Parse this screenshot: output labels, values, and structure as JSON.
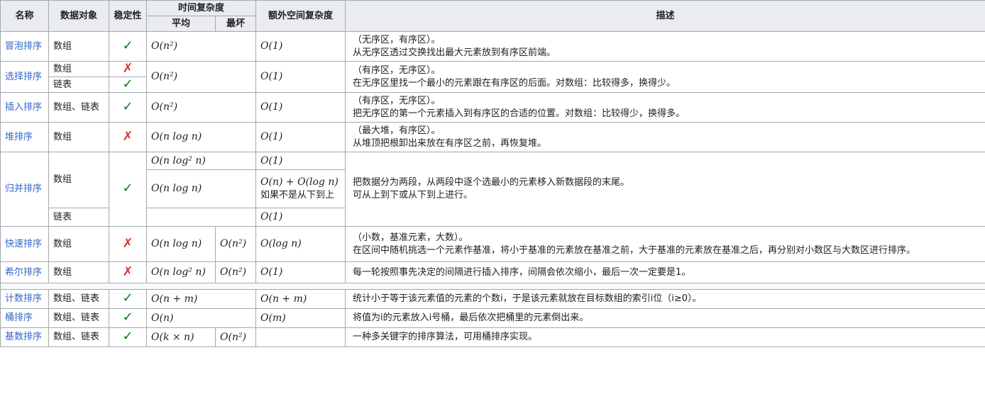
{
  "headers": {
    "name": "名称",
    "data_object": "数据对象",
    "stable": "稳定性",
    "time": "时间复杂度",
    "avg": "平均",
    "worst": "最坏",
    "space": "额外空间复杂度",
    "desc": "描述"
  },
  "icons": {
    "check": "✓",
    "cross": "✗",
    "check_color": "#008000",
    "cross_color": "#dd3333"
  },
  "rows": {
    "bubble": {
      "name": "冒泡排序",
      "obj": "数组",
      "avg": "O(n²)",
      "space": "O(1)",
      "desc1": "（无序区，有序区）。",
      "desc2": "从无序区透过交换找出最大元素放到有序区前端。"
    },
    "selection": {
      "name": "选择排序",
      "obj1": "数组",
      "obj2": "链表",
      "avg": "O(n²)",
      "space": "O(1)",
      "desc1": "（有序区，无序区）。",
      "desc2": "在无序区里找一个最小的元素跟在有序区的后面。对数组：比较得多，换得少。"
    },
    "insertion": {
      "name": "插入排序",
      "obj": "数组、链表",
      "avg": "O(n²)",
      "space": "O(1)",
      "desc1": "（有序区，无序区）。",
      "desc2": "把无序区的第一个元素插入到有序区的合适的位置。对数组：比较得少，换得多。"
    },
    "heap": {
      "name": "堆排序",
      "obj": "数组",
      "avg": "O(n log n)",
      "space": "O(1)",
      "desc1": "（最大堆，有序区）。",
      "desc2": "从堆顶把根卸出来放在有序区之前，再恢复堆。"
    },
    "merge": {
      "name": "归并排序",
      "obj1": "数组",
      "obj2": "链表",
      "avg1": "O(n log² n)",
      "avg2": "O(n log n)",
      "space1": "O(1)",
      "space2": "O(n) + O(log n)",
      "space2_note": "如果不是从下到上",
      "space3": "O(1)",
      "desc1": "把数据分为两段，从两段中逐个选最小的元素移入新数据段的末尾。",
      "desc2": "可从上到下或从下到上进行。"
    },
    "quick": {
      "name": "快速排序",
      "obj": "数组",
      "avg": "O(n log n)",
      "worst": "O(n²)",
      "space": "O(log n)",
      "desc1": "（小数，基准元素，大数）。",
      "desc2": "在区间中随机挑选一个元素作基准，将小于基准的元素放在基准之前，大于基准的元素放在基准之后，再分别对小数区与大数区进行排序。"
    },
    "shell": {
      "name": "希尔排序",
      "obj": "数组",
      "avg": "O(n log² n)",
      "worst": "O(n²)",
      "space": "O(1)",
      "desc": "每一轮按照事先决定的间隔进行插入排序，间隔会依次缩小，最后一次一定要是1。"
    },
    "counting": {
      "name": "计数排序",
      "obj": "数组、链表",
      "avg": "O(n + m)",
      "space": "O(n + m)",
      "desc": "统计小于等于该元素值的元素的个数i，于是该元素就放在目标数组的索引i位（i≥0）。"
    },
    "bucket": {
      "name": "桶排序",
      "obj": "数组、链表",
      "avg": "O(n)",
      "space": "O(m)",
      "desc": "将值为i的元素放入i号桶，最后依次把桶里的元素倒出来。"
    },
    "radix": {
      "name": "基数排序",
      "obj": "数组、链表",
      "avg": "O(k × n)",
      "worst": "O(n²)",
      "desc": "一种多关键字的排序算法，可用桶排序实现。"
    }
  }
}
